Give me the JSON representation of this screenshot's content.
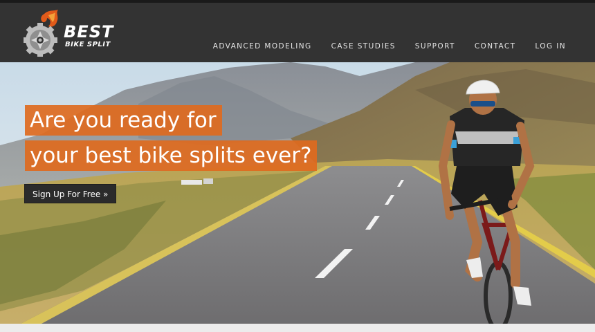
{
  "brand": {
    "name_line1": "BEST",
    "name_line2": "BIKE SPLIT",
    "logo_icon": "gear-flame-icon"
  },
  "nav": {
    "items": [
      {
        "label": "ADVANCED MODELING"
      },
      {
        "label": "CASE STUDIES"
      },
      {
        "label": "SUPPORT"
      },
      {
        "label": "CONTACT"
      },
      {
        "label": "LOG IN"
      }
    ]
  },
  "hero": {
    "headline_line1": "Are you ready for",
    "headline_line2": "your best bike splits ever?",
    "cta_label": "Sign Up For Free »",
    "image": "cyclist-on-mountain-road"
  },
  "colors": {
    "header_bg": "#333333",
    "accent": "#de6a1e",
    "cta_bg": "#2b2b2b"
  }
}
